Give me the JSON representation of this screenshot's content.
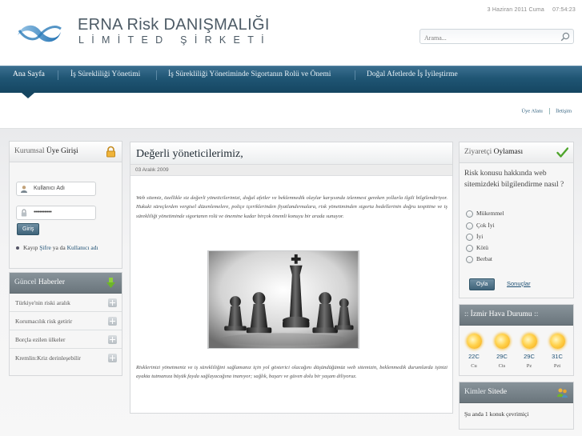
{
  "header": {
    "date": "3 Haziran 2011 Cuma",
    "time": "07:54:23",
    "brand_line1": "ERNA Risk DANIŞMALIĞI",
    "brand_line2": "LİMİTED ŞİRKETİ",
    "search_placeholder": "Arama..."
  },
  "nav": {
    "items": [
      {
        "label": "Ana Sayfa"
      },
      {
        "label": "İş Sürekliliği Yönetimi"
      },
      {
        "label": "İş Sürekliliği Yönetiminde Sigortanın Rolü ve Önemi"
      },
      {
        "label": "Doğal Afetlerde İş İyileştirme"
      }
    ]
  },
  "sublinks": {
    "members": "Üye Alanı",
    "contact": "İletişim"
  },
  "login": {
    "title_plain": "Kurumsal",
    "title_bold": "Üye Girişi",
    "username_value": "Kullanıcı Adı",
    "password_value": "••••••••••••",
    "submit_label": "Giriş",
    "forgot_prefix": "Kayıp",
    "forgot_password": "Şifre",
    "forgot_middle": "ya da",
    "forgot_username": "Kullanıcı adı"
  },
  "news": {
    "title_plain": "Güncel",
    "title_bold": "Haberler",
    "items": [
      {
        "label": "Türkiye'nin riski aralık"
      },
      {
        "label": "Korumacılık risk getirir"
      },
      {
        "label": "Borçla ezilen ülkeler"
      },
      {
        "label": "Kremlin:Kriz derinleşebilir"
      }
    ]
  },
  "article": {
    "title": "Değerli yöneticilerimiz,",
    "date": "03 Aralık 2009",
    "paragraph1": "Web sitemiz, özellikle siz değerli yöneticilerimizi, doğal afetler ve beklenmedik olaylar karşısında izlenmesi gereken yollarla ilgili bilgilendiriyor. Hukuki süreçlerden vergisel düzenlemelere, poliçe içeriklerinden fiyatlandırmalara, risk yönetiminden sigorta bedellerinin doğru tespitine ve iş sürekliliği yönetiminde sigortanın rolü ve önemine kadar birçok önemli konuyu bir arada sunuyor.",
    "paragraph2": "Risklerinizi yönetmeniz ve iş sürekliliğini sağlamanız için yol gösterici olacağını düşündüğümüz web sitemizin, beklenmedik durumlarda işinizi ayakta tutmanıza büyük fayda sağlayacağına inanıyor; sağlık, başarı ve güven dolu bir yaşam diliyoruz."
  },
  "poll": {
    "title_plain": "Ziyaretçi",
    "title_bold": "Oylaması",
    "question": "Risk konusu hakkında web sitemizdeki bilgilendirme nasıl ?",
    "options": [
      {
        "label": "Mükemmel"
      },
      {
        "label": "Çok İyi"
      },
      {
        "label": "İyi"
      },
      {
        "label": "Kötü"
      },
      {
        "label": "Berbat"
      }
    ],
    "vote_label": "Oyla",
    "results_label": "Sonuçlar"
  },
  "weather": {
    "title_plain": "::",
    "title_bold": "İzmir Hava Durumu",
    "title_suffix": "::",
    "days": [
      {
        "temp": "22C",
        "day": "Cu"
      },
      {
        "temp": "29C",
        "day": "Cts"
      },
      {
        "temp": "29C",
        "day": "Pz"
      },
      {
        "temp": "31C",
        "day": "Pzt"
      }
    ]
  },
  "online": {
    "title_plain": "Kimler",
    "title_bold": "Sitede",
    "text": "Şu anda 1 konuk çevrimiçi"
  },
  "colors": {
    "nav_bar": "#1f5574",
    "link": "#1d4f73",
    "brand_text": "#4d5b66"
  }
}
